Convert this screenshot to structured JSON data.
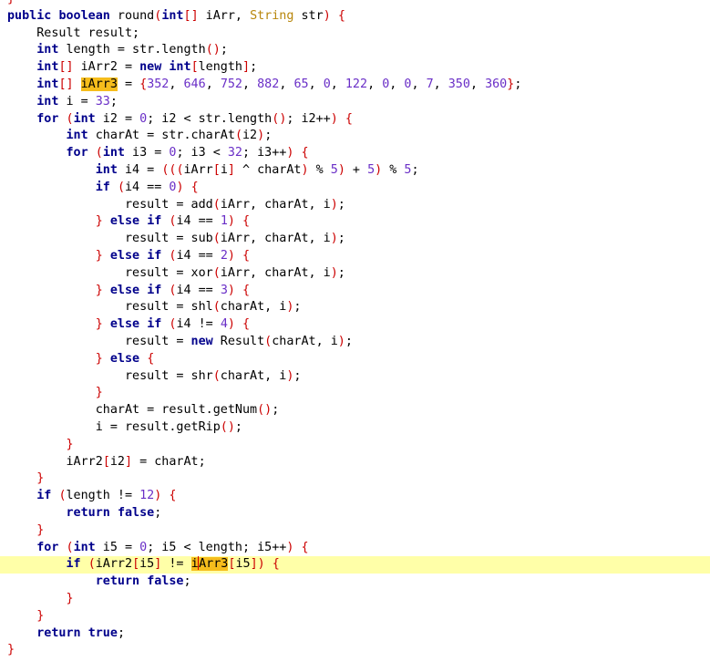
{
  "editor": {
    "highlighted_identifier": "iArr3",
    "current_line_index": 33,
    "colors": {
      "keyword": "#00008b",
      "class_type": "#b8860b",
      "number": "#6a2fc7",
      "brace": "#cc0000",
      "current_line": "#ffffa8",
      "occurrence_highlight": "#f6bd1c"
    },
    "lines": [
      "}",
      "public boolean round(int[] iArr, String str) {",
      "    Result result;",
      "    int length = str.length();",
      "    int[] iArr2 = new int[length];",
      "    int[] iArr3 = {352, 646, 752, 882, 65, 0, 122, 0, 0, 7, 350, 360};",
      "    int i = 33;",
      "    for (int i2 = 0; i2 < str.length(); i2++) {",
      "        int charAt = str.charAt(i2);",
      "        for (int i3 = 0; i3 < 32; i3++) {",
      "            int i4 = (((iArr[i] ^ charAt) % 5) + 5) % 5;",
      "            if (i4 == 0) {",
      "                result = add(iArr, charAt, i);",
      "            } else if (i4 == 1) {",
      "                result = sub(iArr, charAt, i);",
      "            } else if (i4 == 2) {",
      "                result = xor(iArr, charAt, i);",
      "            } else if (i4 == 3) {",
      "                result = shl(charAt, i);",
      "            } else if (i4 != 4) {",
      "                result = new Result(charAt, i);",
      "            } else {",
      "                result = shr(charAt, i);",
      "            }",
      "            charAt = result.getNum();",
      "            i = result.getRip();",
      "        }",
      "        iArr2[i2] = charAt;",
      "    }",
      "    if (length != 12) {",
      "        return false;",
      "    }",
      "    for (int i5 = 0; i5 < length; i5++) {",
      "        if (iArr2[i5] != iArr3[i5]) {",
      "            return false;",
      "        }",
      "    }",
      "    return true;",
      "}"
    ]
  }
}
